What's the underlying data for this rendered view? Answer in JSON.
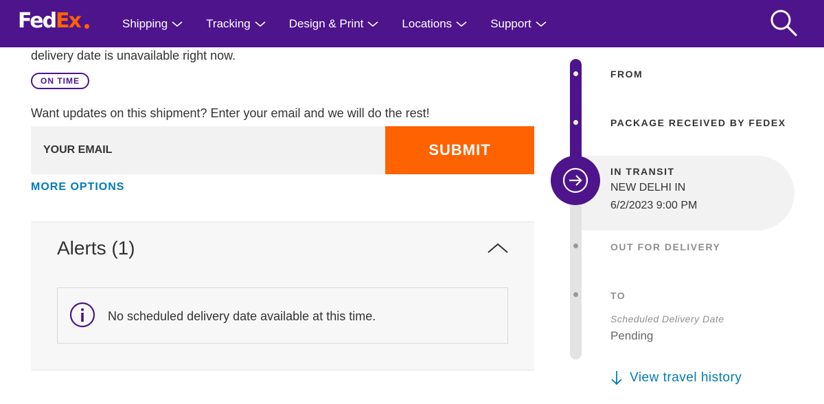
{
  "header": {
    "logo": {
      "part1": "Fed",
      "part2": "Ex"
    },
    "nav": [
      {
        "label": "Shipping"
      },
      {
        "label": "Tracking"
      },
      {
        "label": "Design & Print"
      },
      {
        "label": "Locations"
      },
      {
        "label": "Support"
      }
    ]
  },
  "shipment": {
    "intro_text": "delivery date is unavailable right now.",
    "status_badge": "ON TIME",
    "updates_prompt": "Want updates on this shipment? Enter your email and we will do the rest!",
    "email_placeholder": "YOUR EMAIL",
    "submit_label": "SUBMIT",
    "more_options_label": "MORE OPTIONS"
  },
  "alerts": {
    "title": "Alerts (1)",
    "items": [
      {
        "text": "No scheduled delivery date available at this time."
      }
    ]
  },
  "progress": {
    "steps": [
      {
        "label": "FROM"
      },
      {
        "label": "PACKAGE RECEIVED BY FEDEX"
      },
      {
        "label": "IN TRANSIT",
        "location": "NEW DELHI IN",
        "datetime": "6/2/2023 9:00 PM"
      },
      {
        "label": "OUT FOR DELIVERY"
      },
      {
        "label": "TO"
      }
    ],
    "scheduled_label": "Scheduled Delivery Date",
    "scheduled_value": "Pending",
    "travel_history_label": "View travel history"
  },
  "colors": {
    "brand_purple": "#4d148c",
    "brand_orange": "#ff6200",
    "link_blue": "#007ab7"
  }
}
